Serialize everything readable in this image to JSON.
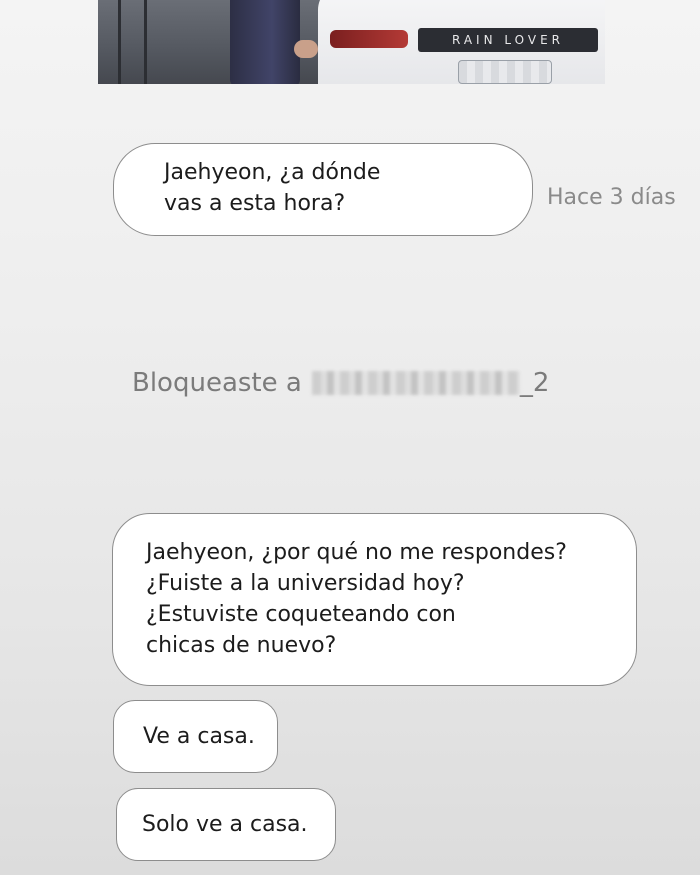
{
  "header_image": {
    "car_badge_text": "RAIN LOVER"
  },
  "messages": [
    {
      "lines": [
        "Jaehyeon, ¿a dónde",
        "vas a esta hora?"
      ],
      "timestamp": "Hace 3 días"
    },
    {
      "lines": [
        "Jaehyeon, ¿por qué no me respondes?",
        "¿Fuiste a la universidad hoy?",
        "¿Estuviste coqueteando con",
        "chicas de nuevo?"
      ]
    },
    {
      "lines": [
        "Ve a casa."
      ]
    },
    {
      "lines": [
        "Solo ve a casa."
      ]
    }
  ],
  "system_notice": {
    "prefix": "Bloqueaste a",
    "suffix": "_2"
  }
}
